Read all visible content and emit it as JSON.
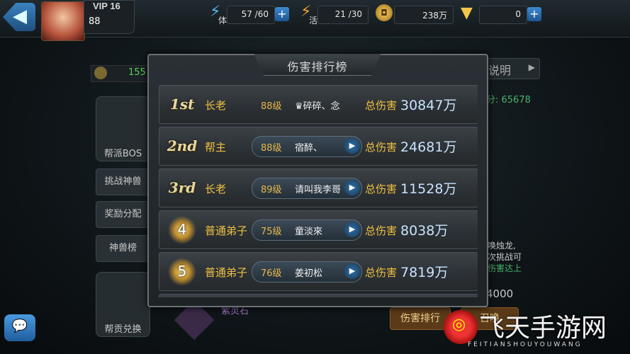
{
  "topbar": {
    "vip": "VIP 16",
    "level": "88",
    "stamina": {
      "icon_label": "体",
      "value": "57 /60"
    },
    "vitality": {
      "icon_label": "活",
      "value": "21 /30"
    },
    "coins": {
      "value": "238万"
    },
    "gold": {
      "value": "0"
    },
    "plus": "+"
  },
  "background": {
    "points_left": "155",
    "explain_label": "说明",
    "score_label": "分: 65678",
    "side_items": [
      "帮派BOS",
      "挑战神兽",
      "奖励分配",
      "神兽榜",
      "帮贡兑换"
    ],
    "right_texts": [
      "唤烛龙,",
      "次挑战可",
      "伤害达上"
    ],
    "right_value": "4000",
    "bottom_item": "紫灵石",
    "btn_damage_rank": "伤害排行",
    "btn_summon": "召唤"
  },
  "modal": {
    "title": "伤害排行榜",
    "damage_label": "总伤害",
    "rows": [
      {
        "rank": "1st",
        "role": "长老",
        "level": "88级",
        "name": "♛碎碎、念",
        "damage": "30847万",
        "has_button": false
      },
      {
        "rank": "2nd",
        "role": "帮主",
        "level": "88级",
        "name": "宿醉、",
        "damage": "24681万",
        "has_button": true
      },
      {
        "rank": "3rd",
        "role": "长老",
        "level": "89级",
        "name": "请叫我李哥",
        "damage": "11528万",
        "has_button": true
      },
      {
        "rank": "4",
        "role": "普通弟子",
        "level": "75级",
        "name": "童淡來",
        "damage": "8038万",
        "has_button": true
      },
      {
        "rank": "5",
        "role": "普通弟子",
        "level": "76级",
        "name": "姜初松",
        "damage": "7819万",
        "has_button": true
      }
    ]
  },
  "watermark": {
    "cn": "飞天手游网",
    "en": "FEITIANSHOUYOUWANG"
  }
}
